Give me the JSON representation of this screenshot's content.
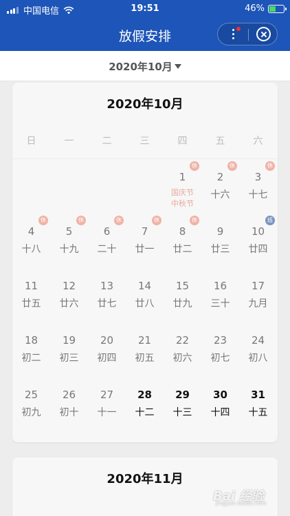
{
  "status_bar": {
    "carrier": "中国电信",
    "time": "19:51",
    "battery": "46%",
    "battery_fraction": 0.46
  },
  "nav": {
    "title": "放假安排"
  },
  "selector": {
    "label": "2020年10月"
  },
  "weekdays": [
    "日",
    "一",
    "二",
    "三",
    "四",
    "五",
    "六"
  ],
  "october": {
    "title": "2020年10月",
    "days": [
      {
        "n": "1",
        "lunar": "",
        "fest": [
          "国庆节",
          "中秋节"
        ],
        "badge": "休",
        "type": "rest"
      },
      {
        "n": "2",
        "lunar": "十六",
        "badge": "休",
        "type": "rest"
      },
      {
        "n": "3",
        "lunar": "十七",
        "badge": "休",
        "type": "rest"
      },
      {
        "n": "4",
        "lunar": "十八",
        "badge": "休",
        "type": "rest"
      },
      {
        "n": "5",
        "lunar": "十九",
        "badge": "休",
        "type": "rest"
      },
      {
        "n": "6",
        "lunar": "二十",
        "badge": "休",
        "type": "rest"
      },
      {
        "n": "7",
        "lunar": "廿一",
        "badge": "休",
        "type": "rest"
      },
      {
        "n": "8",
        "lunar": "廿二",
        "badge": "休",
        "type": "rest"
      },
      {
        "n": "9",
        "lunar": "廿三"
      },
      {
        "n": "10",
        "lunar": "廿四",
        "badge": "班",
        "type": "work"
      },
      {
        "n": "11",
        "lunar": "廿五"
      },
      {
        "n": "12",
        "lunar": "廿六"
      },
      {
        "n": "13",
        "lunar": "廿七"
      },
      {
        "n": "14",
        "lunar": "廿八"
      },
      {
        "n": "15",
        "lunar": "廿九"
      },
      {
        "n": "16",
        "lunar": "三十"
      },
      {
        "n": "17",
        "lunar": "九月"
      },
      {
        "n": "18",
        "lunar": "初二"
      },
      {
        "n": "19",
        "lunar": "初三"
      },
      {
        "n": "20",
        "lunar": "初四"
      },
      {
        "n": "21",
        "lunar": "初五"
      },
      {
        "n": "22",
        "lunar": "初六"
      },
      {
        "n": "23",
        "lunar": "初七"
      },
      {
        "n": "24",
        "lunar": "初八"
      },
      {
        "n": "25",
        "lunar": "初九"
      },
      {
        "n": "26",
        "lunar": "初十"
      },
      {
        "n": "27",
        "lunar": "十一"
      },
      {
        "n": "28",
        "lunar": "十二",
        "dark": true
      },
      {
        "n": "29",
        "lunar": "十三",
        "dark": true
      },
      {
        "n": "30",
        "lunar": "十四",
        "dark": true
      },
      {
        "n": "31",
        "lunar": "十五",
        "dark": true
      }
    ]
  },
  "november": {
    "title": "2020年11月"
  },
  "watermark": {
    "logo": "Bai 经验",
    "sub": "jingyan.baidu.com"
  },
  "colors": {
    "brand_blue": "#1d55b8",
    "rest_badge": "#f0b3a7",
    "work_badge": "#7a94bf",
    "festival_text": "#e8a89a"
  }
}
